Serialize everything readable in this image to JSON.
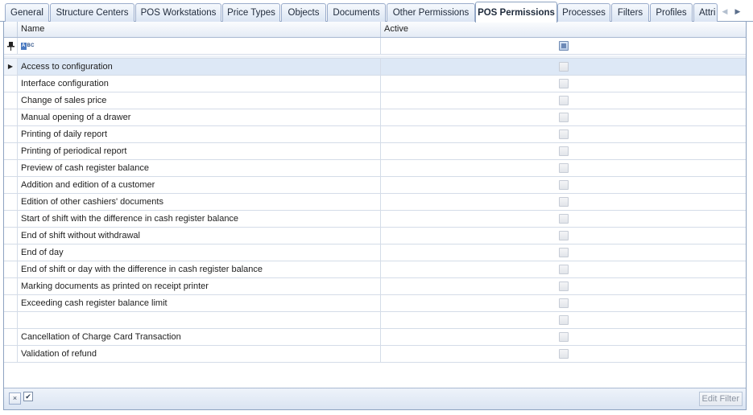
{
  "tabs": [
    {
      "label": "General"
    },
    {
      "label": "Structure Centers"
    },
    {
      "label": "POS Workstations"
    },
    {
      "label": "Price Types"
    },
    {
      "label": "Objects"
    },
    {
      "label": "Documents"
    },
    {
      "label": "Other Permissions"
    },
    {
      "label": "POS Permissions",
      "active": true
    },
    {
      "label": "Processes"
    },
    {
      "label": "Filters"
    },
    {
      "label": "Profiles"
    },
    {
      "label": "Attri"
    }
  ],
  "tab_nav": {
    "prev": "◀",
    "next": "▶"
  },
  "grid": {
    "columns": {
      "name": "Name",
      "active": "Active"
    },
    "filter_row": {
      "pin_icon": "📌",
      "text_filter_icon": "ABC"
    },
    "selected_row_indicator": "▶",
    "rows": [
      {
        "name": "Access to configuration",
        "active": false,
        "selected": true
      },
      {
        "name": "Interface configuration",
        "active": false
      },
      {
        "name": "Change of sales price",
        "active": false
      },
      {
        "name": "Manual opening of a drawer",
        "active": false
      },
      {
        "name": "Printing of daily report",
        "active": false
      },
      {
        "name": "Printing of periodical report",
        "active": false
      },
      {
        "name": "Preview of cash register balance",
        "active": false
      },
      {
        "name": "Addition and edition of a customer",
        "active": false
      },
      {
        "name": "Edition of other cashiers' documents",
        "active": false
      },
      {
        "name": "Start of shift with the difference in cash register balance",
        "active": false
      },
      {
        "name": "End of shift without withdrawal",
        "active": false
      },
      {
        "name": "End of day",
        "active": false
      },
      {
        "name": "End of shift or day with the difference in cash register balance",
        "active": false
      },
      {
        "name": "Marking documents as printed on receipt printer",
        "active": false
      },
      {
        "name": "Exceeding cash register balance limit",
        "active": false
      },
      {
        "name": "",
        "active": false
      },
      {
        "name": "Cancellation of Charge Card Transaction",
        "active": false
      },
      {
        "name": "Validation of refund",
        "active": false
      }
    ]
  },
  "footer": {
    "clear_filter_icon": "×",
    "filter_enabled_icon": "✔",
    "edit_filter_label": "Edit Filter"
  },
  "colors": {
    "accent": "#8ea3c1",
    "selected_row": "#dde8f6",
    "header_bg": "#e4ebf5"
  }
}
